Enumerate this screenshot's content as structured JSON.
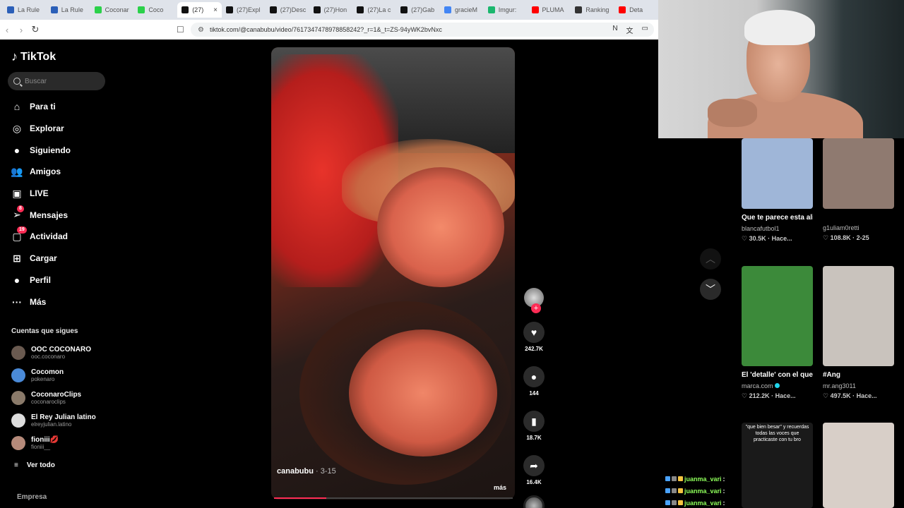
{
  "browser": {
    "tabs": [
      {
        "label": "La Rule",
        "color": "#2b5fb8"
      },
      {
        "label": "La Rule",
        "color": "#2b5fb8"
      },
      {
        "label": "Coconar",
        "color": "#2bd14a"
      },
      {
        "label": "Coco",
        "color": "#2bd14a"
      },
      {
        "label": "(27)",
        "color": "#111111",
        "active": true
      },
      {
        "label": "(27)Expl",
        "color": "#111111"
      },
      {
        "label": "(27)Desc",
        "color": "#111111"
      },
      {
        "label": "(27)Hon",
        "color": "#111111"
      },
      {
        "label": "(27)La c",
        "color": "#111111"
      },
      {
        "label": "(27)Gab",
        "color": "#111111"
      },
      {
        "label": "gracieM",
        "color": "#4285f4"
      },
      {
        "label": "Imgur:",
        "color": "#1bb76e"
      },
      {
        "label": "PLUMA",
        "color": "#ff0000"
      },
      {
        "label": "Ranking",
        "color": "#333333"
      },
      {
        "label": "Deta",
        "color": "#ff0000"
      }
    ],
    "tab_close": "×",
    "url": "tiktok.com/@canabubu/video/7617347478978858242?_r=1&_t=ZS-94yWK2bvNxc"
  },
  "sidebar": {
    "logo": "TikTok",
    "search_placeholder": "Buscar",
    "nav": [
      {
        "label": "Para ti",
        "icon": "home-icon",
        "glyph": "⌂"
      },
      {
        "label": "Explorar",
        "icon": "compass-icon",
        "glyph": "◎"
      },
      {
        "label": "Siguiendo",
        "icon": "following-avatar-icon",
        "glyph": "●"
      },
      {
        "label": "Amigos",
        "icon": "friends-icon",
        "glyph": "👥"
      },
      {
        "label": "LIVE",
        "icon": "live-icon",
        "glyph": "▣"
      },
      {
        "label": "Mensajes",
        "icon": "messages-icon",
        "glyph": "➢",
        "badge": "8"
      },
      {
        "label": "Actividad",
        "icon": "activity-icon",
        "glyph": "▢",
        "badge": "19"
      },
      {
        "label": "Cargar",
        "icon": "upload-icon",
        "glyph": "⊞"
      },
      {
        "label": "Perfil",
        "icon": "profile-icon",
        "glyph": "●"
      },
      {
        "label": "Más",
        "icon": "more-icon",
        "glyph": "···"
      }
    ],
    "following_title": "Cuentas que sigues",
    "following": [
      {
        "name": "OOC COCONARO",
        "handle": "ooc.coconaro",
        "color": "#6a5a50"
      },
      {
        "name": "Cocomon",
        "handle": "pokenaro",
        "color": "#4a8ad8"
      },
      {
        "name": "CoconaroClips",
        "handle": "coconaroclips",
        "color": "#8a7a6a"
      },
      {
        "name": "El Rey Julian latino",
        "handle": "elreyjulian.latino",
        "color": "#dddddd"
      },
      {
        "name": "fioniii💋",
        "handle": "fioniii__",
        "color": "#b58a7a"
      }
    ],
    "see_all": "Ver todo",
    "footer": "Empresa"
  },
  "video": {
    "author": "canabubu",
    "date": "3-15",
    "more": "más",
    "progress": 0.22,
    "likes": "242.7K",
    "comments": "144",
    "saves": "18.7K",
    "shares": "16.4K"
  },
  "grid": [
    {
      "title": "Que te parece esta alineación Madri...",
      "author": "blancafutbol1",
      "stats": "♡ 30.5K · Hace...",
      "bg": "#9fb6d8"
    },
    {
      "title": "",
      "author": "g1uliam0retti",
      "stats": "♡ 108.8K · 2-25",
      "bg": "#8f7a70"
    },
    {
      "title": "El 'detalle' con el que han tenido...",
      "author": "marca.com",
      "stats": "♡ 212.2K · Hace...",
      "bg": "#3c8a3a",
      "verified": true
    },
    {
      "title": "#Ang",
      "author": "mr.ang3011",
      "stats": "♡ 497.5K · Hace...",
      "bg": "#c9c3bd"
    },
    {
      "title": "",
      "author": "",
      "stats": "",
      "bg": "#1a1a1a",
      "caption": "\"que bien besar\" y recuerdas todas las voces que practicaste con tu bro"
    },
    {
      "title": "",
      "author": "",
      "stats": "",
      "bg": "#d8cfc8"
    }
  ],
  "chat": [
    {
      "user": "juanma_vari",
      "sep": ":"
    },
    {
      "user": "juanma_vari",
      "sep": ":"
    },
    {
      "user": "juanma_vari",
      "sep": ":"
    }
  ]
}
